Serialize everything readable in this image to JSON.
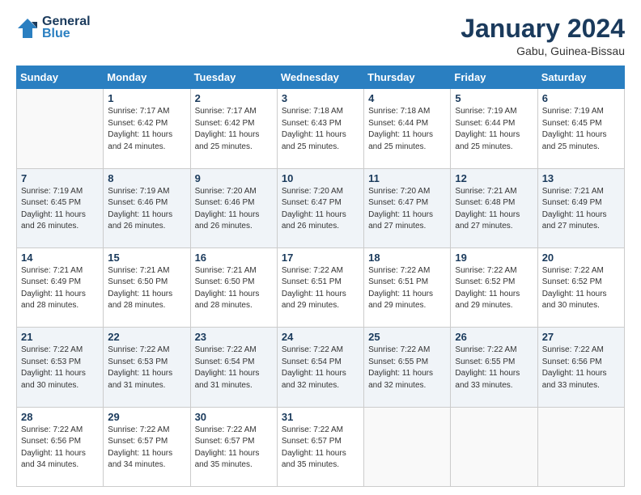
{
  "header": {
    "logo_line1": "General",
    "logo_line2": "Blue",
    "month_year": "January 2024",
    "location": "Gabu, Guinea-Bissau"
  },
  "days_of_week": [
    "Sunday",
    "Monday",
    "Tuesday",
    "Wednesday",
    "Thursday",
    "Friday",
    "Saturday"
  ],
  "weeks": [
    [
      {
        "num": "",
        "info": ""
      },
      {
        "num": "1",
        "info": "Sunrise: 7:17 AM\nSunset: 6:42 PM\nDaylight: 11 hours\nand 24 minutes."
      },
      {
        "num": "2",
        "info": "Sunrise: 7:17 AM\nSunset: 6:42 PM\nDaylight: 11 hours\nand 25 minutes."
      },
      {
        "num": "3",
        "info": "Sunrise: 7:18 AM\nSunset: 6:43 PM\nDaylight: 11 hours\nand 25 minutes."
      },
      {
        "num": "4",
        "info": "Sunrise: 7:18 AM\nSunset: 6:44 PM\nDaylight: 11 hours\nand 25 minutes."
      },
      {
        "num": "5",
        "info": "Sunrise: 7:19 AM\nSunset: 6:44 PM\nDaylight: 11 hours\nand 25 minutes."
      },
      {
        "num": "6",
        "info": "Sunrise: 7:19 AM\nSunset: 6:45 PM\nDaylight: 11 hours\nand 25 minutes."
      }
    ],
    [
      {
        "num": "7",
        "info": "Sunrise: 7:19 AM\nSunset: 6:45 PM\nDaylight: 11 hours\nand 26 minutes."
      },
      {
        "num": "8",
        "info": "Sunrise: 7:19 AM\nSunset: 6:46 PM\nDaylight: 11 hours\nand 26 minutes."
      },
      {
        "num": "9",
        "info": "Sunrise: 7:20 AM\nSunset: 6:46 PM\nDaylight: 11 hours\nand 26 minutes."
      },
      {
        "num": "10",
        "info": "Sunrise: 7:20 AM\nSunset: 6:47 PM\nDaylight: 11 hours\nand 26 minutes."
      },
      {
        "num": "11",
        "info": "Sunrise: 7:20 AM\nSunset: 6:47 PM\nDaylight: 11 hours\nand 27 minutes."
      },
      {
        "num": "12",
        "info": "Sunrise: 7:21 AM\nSunset: 6:48 PM\nDaylight: 11 hours\nand 27 minutes."
      },
      {
        "num": "13",
        "info": "Sunrise: 7:21 AM\nSunset: 6:49 PM\nDaylight: 11 hours\nand 27 minutes."
      }
    ],
    [
      {
        "num": "14",
        "info": "Sunrise: 7:21 AM\nSunset: 6:49 PM\nDaylight: 11 hours\nand 28 minutes."
      },
      {
        "num": "15",
        "info": "Sunrise: 7:21 AM\nSunset: 6:50 PM\nDaylight: 11 hours\nand 28 minutes."
      },
      {
        "num": "16",
        "info": "Sunrise: 7:21 AM\nSunset: 6:50 PM\nDaylight: 11 hours\nand 28 minutes."
      },
      {
        "num": "17",
        "info": "Sunrise: 7:22 AM\nSunset: 6:51 PM\nDaylight: 11 hours\nand 29 minutes."
      },
      {
        "num": "18",
        "info": "Sunrise: 7:22 AM\nSunset: 6:51 PM\nDaylight: 11 hours\nand 29 minutes."
      },
      {
        "num": "19",
        "info": "Sunrise: 7:22 AM\nSunset: 6:52 PM\nDaylight: 11 hours\nand 29 minutes."
      },
      {
        "num": "20",
        "info": "Sunrise: 7:22 AM\nSunset: 6:52 PM\nDaylight: 11 hours\nand 30 minutes."
      }
    ],
    [
      {
        "num": "21",
        "info": "Sunrise: 7:22 AM\nSunset: 6:53 PM\nDaylight: 11 hours\nand 30 minutes."
      },
      {
        "num": "22",
        "info": "Sunrise: 7:22 AM\nSunset: 6:53 PM\nDaylight: 11 hours\nand 31 minutes."
      },
      {
        "num": "23",
        "info": "Sunrise: 7:22 AM\nSunset: 6:54 PM\nDaylight: 11 hours\nand 31 minutes."
      },
      {
        "num": "24",
        "info": "Sunrise: 7:22 AM\nSunset: 6:54 PM\nDaylight: 11 hours\nand 32 minutes."
      },
      {
        "num": "25",
        "info": "Sunrise: 7:22 AM\nSunset: 6:55 PM\nDaylight: 11 hours\nand 32 minutes."
      },
      {
        "num": "26",
        "info": "Sunrise: 7:22 AM\nSunset: 6:55 PM\nDaylight: 11 hours\nand 33 minutes."
      },
      {
        "num": "27",
        "info": "Sunrise: 7:22 AM\nSunset: 6:56 PM\nDaylight: 11 hours\nand 33 minutes."
      }
    ],
    [
      {
        "num": "28",
        "info": "Sunrise: 7:22 AM\nSunset: 6:56 PM\nDaylight: 11 hours\nand 34 minutes."
      },
      {
        "num": "29",
        "info": "Sunrise: 7:22 AM\nSunset: 6:57 PM\nDaylight: 11 hours\nand 34 minutes."
      },
      {
        "num": "30",
        "info": "Sunrise: 7:22 AM\nSunset: 6:57 PM\nDaylight: 11 hours\nand 35 minutes."
      },
      {
        "num": "31",
        "info": "Sunrise: 7:22 AM\nSunset: 6:57 PM\nDaylight: 11 hours\nand 35 minutes."
      },
      {
        "num": "",
        "info": ""
      },
      {
        "num": "",
        "info": ""
      },
      {
        "num": "",
        "info": ""
      }
    ]
  ]
}
